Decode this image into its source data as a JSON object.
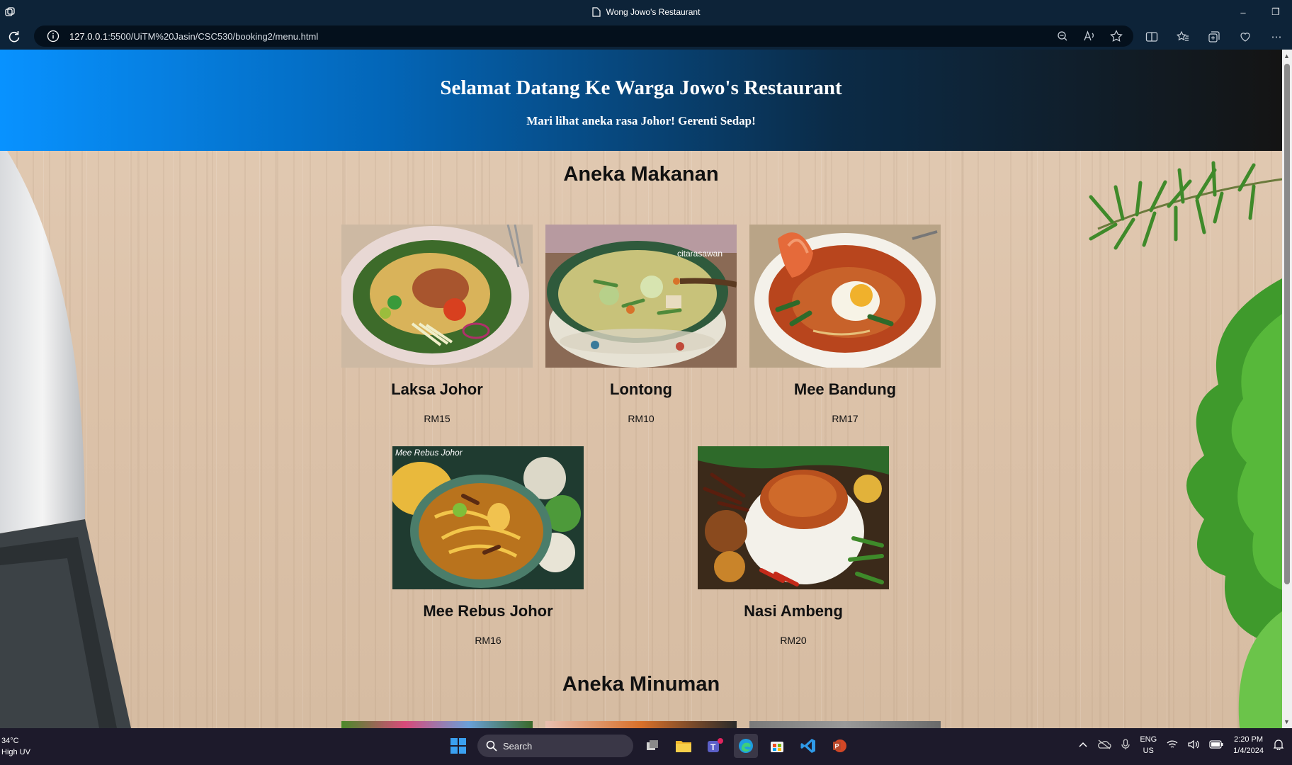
{
  "window": {
    "tab_title": "Wong Jowo's Restaurant",
    "controls": [
      "–",
      "❐"
    ]
  },
  "address_bar": {
    "url_host": "127.0.0.1",
    "url_rest": ":5500/UiTM%20Jasin/CSC530/booking2/menu.html"
  },
  "hero": {
    "title": "Selamat Datang Ke Warga Jowo's Restaurant",
    "subtitle": "Mari lihat aneka rasa Johor! Gerenti Sedap!"
  },
  "sections": {
    "food_title": "Aneka Makanan",
    "drinks_title": "Aneka Minuman"
  },
  "food_items": [
    {
      "name": "Laksa Johor",
      "price": "RM15"
    },
    {
      "name": "Lontong",
      "price": "RM10",
      "watermark": "citarasawan"
    },
    {
      "name": "Mee Bandung",
      "price": "RM17"
    },
    {
      "name": "Mee Rebus Johor",
      "price": "RM16",
      "watermark": "Mee Rebus Johor"
    },
    {
      "name": "Nasi Ambeng",
      "price": "RM20"
    }
  ],
  "taskbar": {
    "weather_temp": "34°C",
    "weather_desc": "High UV",
    "search_label": "Search",
    "lang_top": "ENG",
    "lang_bottom": "US",
    "time": "2:20 PM",
    "date": "1/4/2024"
  },
  "colors": {
    "hero_start": "#0892ff",
    "hero_end": "#141414",
    "chrome": "#0d2338",
    "taskbar": "#1d1a2b"
  }
}
